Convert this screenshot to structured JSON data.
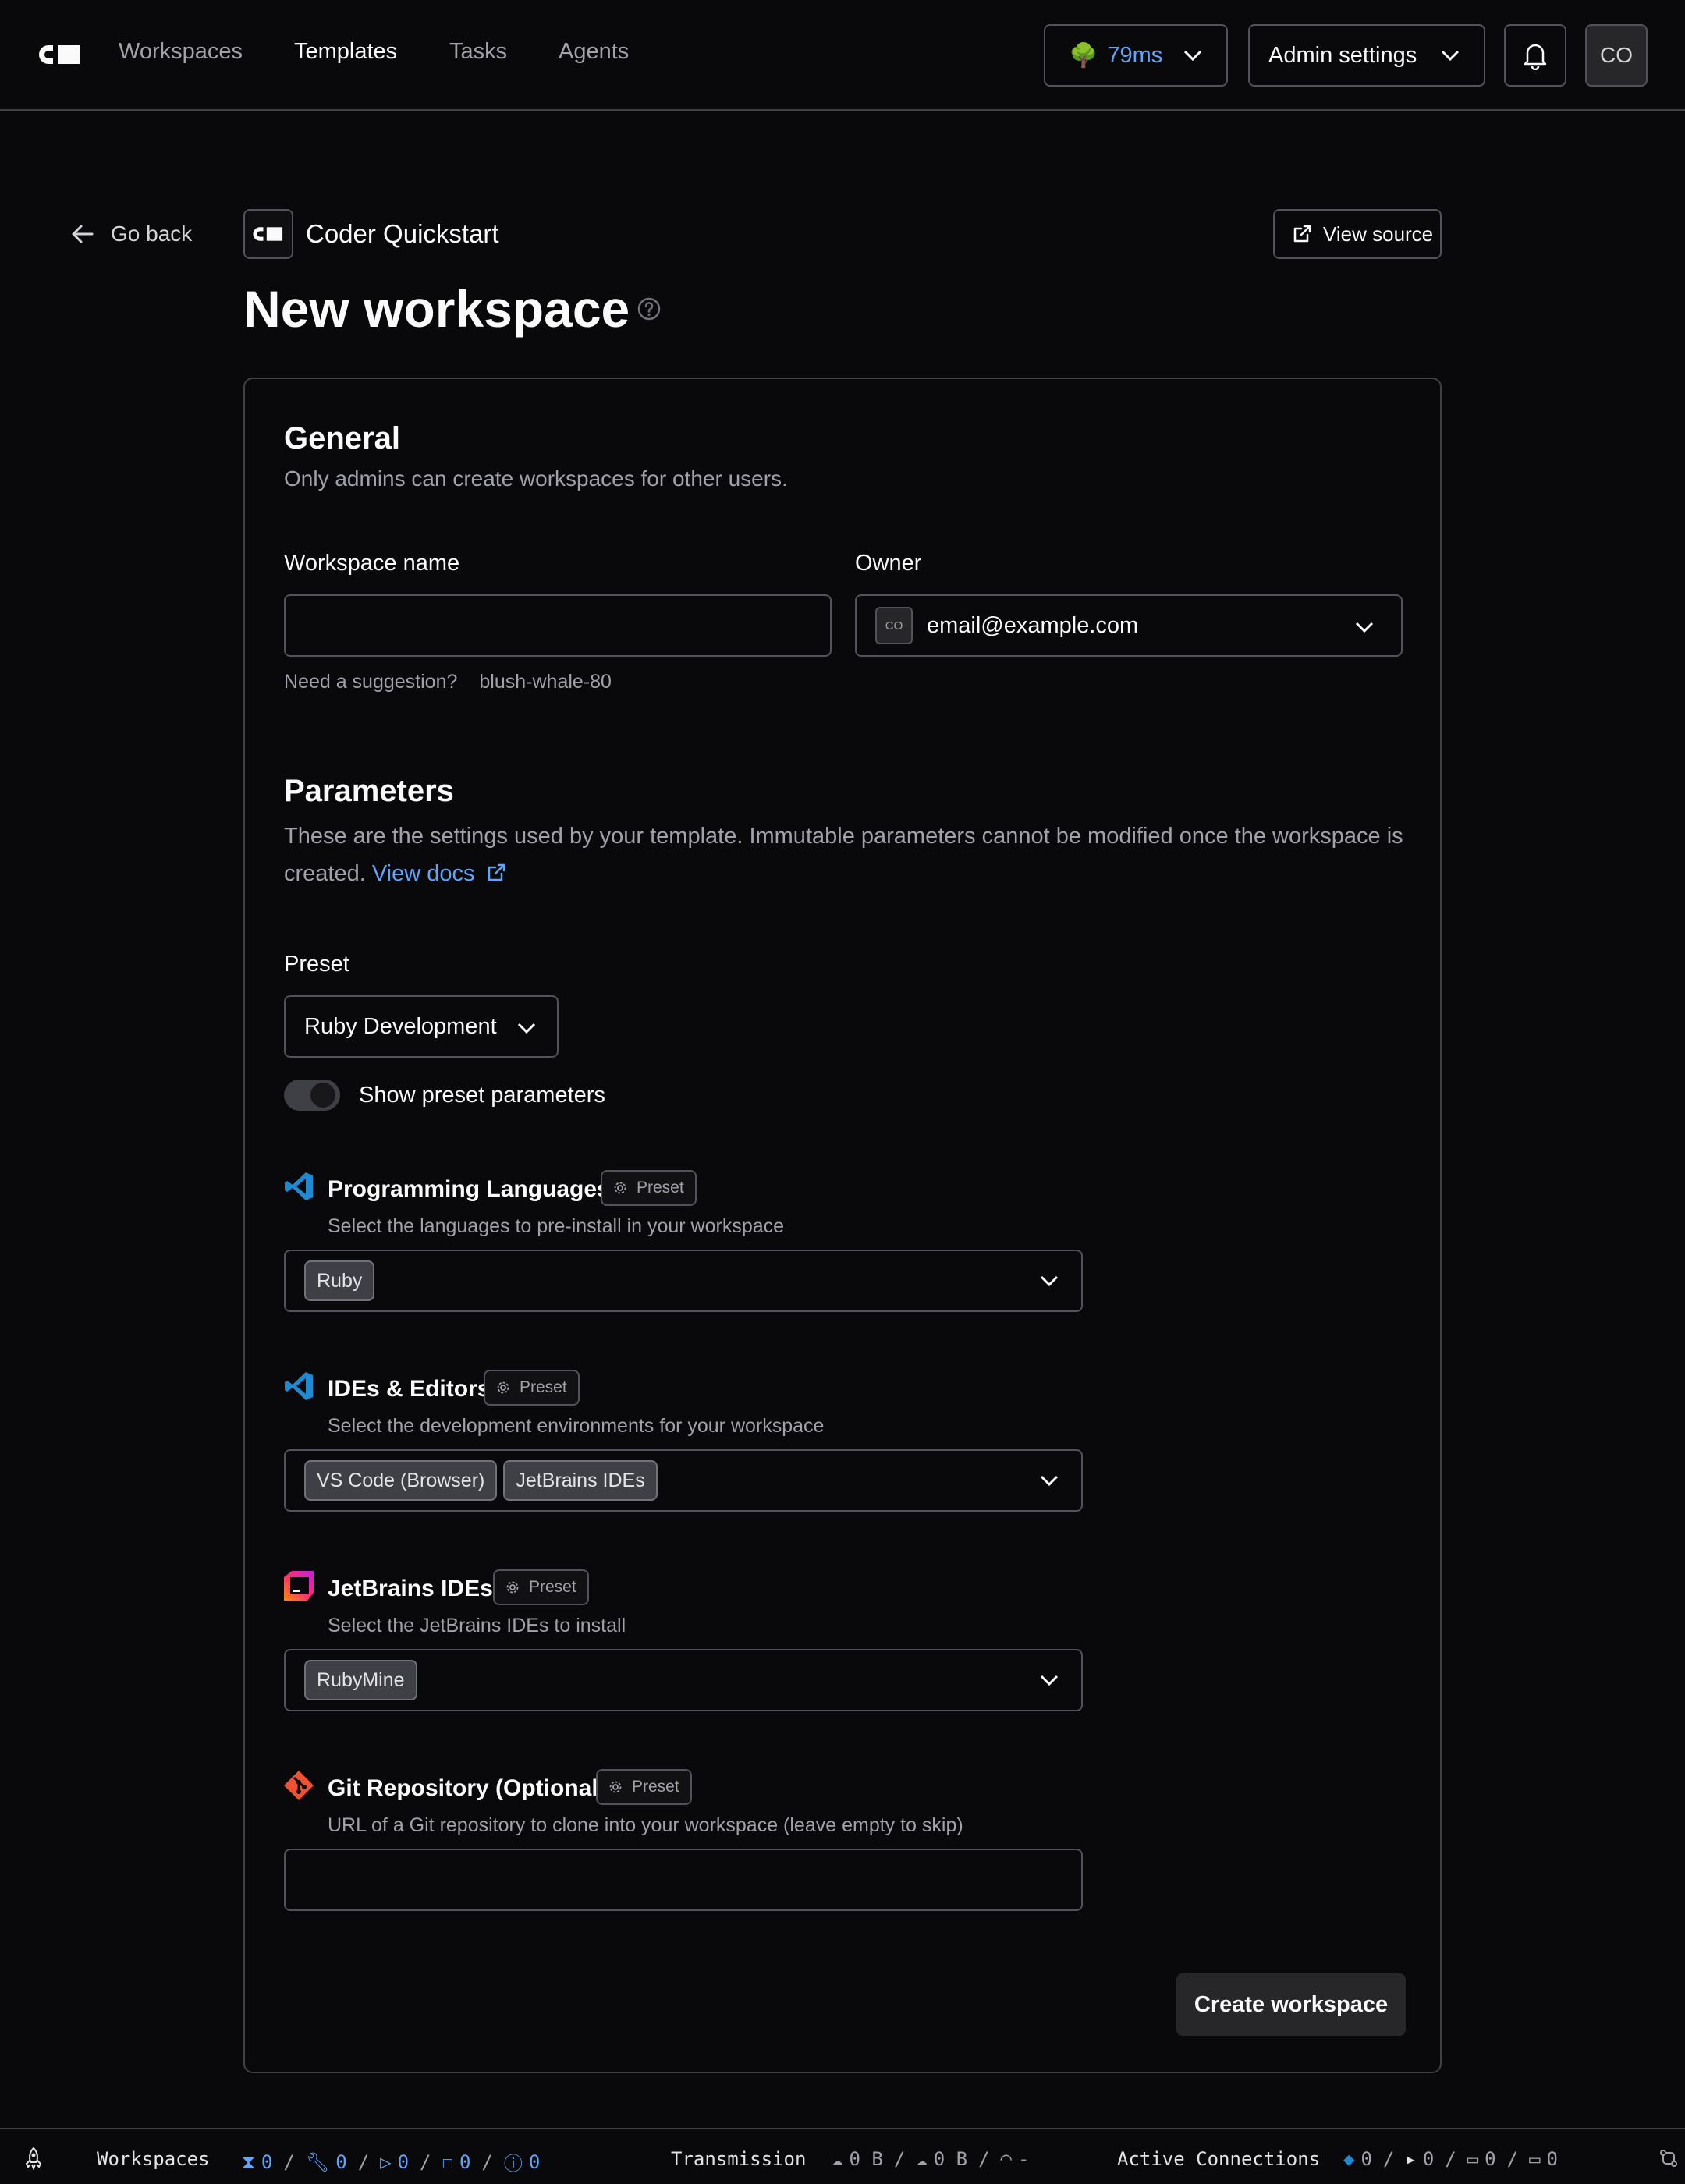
{
  "nav": {
    "links": [
      "Workspaces",
      "Templates",
      "Tasks",
      "Agents"
    ],
    "latency": "79ms",
    "admin_label": "Admin settings",
    "avatar": "CO"
  },
  "header": {
    "go_back": "Go back",
    "template_name": "Coder Quickstart",
    "view_source": "View source",
    "title": "New workspace"
  },
  "general": {
    "heading": "General",
    "description": "Only admins can create workspaces for other users.",
    "name_label": "Workspace name",
    "name_value": "",
    "owner_label": "Owner",
    "owner_avatar": "CO",
    "owner_email": "email@example.com",
    "suggestion_label": "Need a suggestion?",
    "suggestion_value": "blush-whale-80"
  },
  "parameters": {
    "heading": "Parameters",
    "description": "These are the settings used by your template. Immutable parameters cannot be modified once the workspace is created.",
    "docs_link": "View docs",
    "preset_label": "Preset",
    "preset_value": "Ruby Development",
    "toggle_label": "Show preset parameters",
    "toggle_on": false,
    "badge_label": "Preset",
    "items": [
      {
        "title": "Programming Languages",
        "description": "Select the languages to pre-install in your workspace",
        "chips": [
          "Ruby"
        ],
        "icon": "vscode-icon"
      },
      {
        "title": "IDEs & Editors",
        "description": "Select the development environments for your workspace",
        "chips": [
          "VS Code (Browser)",
          "JetBrains IDEs"
        ],
        "icon": "vscode-icon"
      },
      {
        "title": "JetBrains IDEs",
        "description": "Select the JetBrains IDEs to install",
        "chips": [
          "RubyMine"
        ],
        "icon": "jetbrains-icon"
      },
      {
        "title": "Git Repository (Optional)",
        "description": "URL of a Git repository to clone into your workspace (leave empty to skip)",
        "value": "",
        "icon": "git-icon"
      }
    ],
    "create_button": "Create workspace"
  },
  "statusbar": {
    "workspaces_label": "Workspaces",
    "workspace_counts": [
      "0",
      "0",
      "0",
      "0",
      "0"
    ],
    "transmission_label": "Transmission",
    "download": "0 B",
    "upload": "0 B",
    "latency": "-",
    "connections_label": "Active Connections",
    "connection_counts": [
      "0",
      "0",
      "0",
      "0"
    ]
  },
  "colors": {
    "background": "#09090b",
    "border": "#3f3f46",
    "accent": "#60a5fa",
    "muted": "#a1a1aa"
  }
}
